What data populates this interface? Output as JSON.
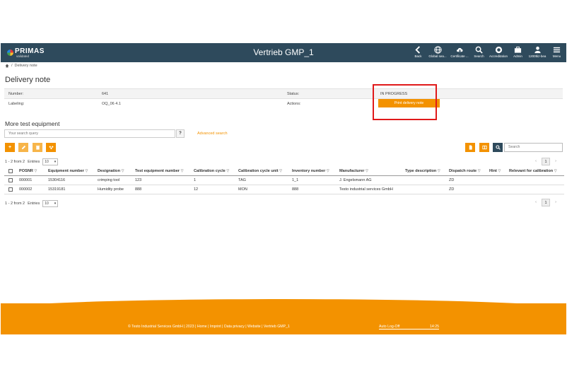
{
  "header": {
    "logo_text": "PRIMAS",
    "logo_sub": "validated",
    "title": "Vertrieb GMP_1",
    "nav": [
      {
        "label": "Back",
        "icon": "back-icon"
      },
      {
        "label": "Global sea...",
        "icon": "globe-icon"
      },
      {
        "label": "Certificate ...",
        "icon": "cloud-download-icon"
      },
      {
        "label": "Search",
        "icon": "search-icon"
      },
      {
        "label": "Accreditation",
        "icon": "seal-icon"
      },
      {
        "label": "Admin",
        "icon": "briefcase-icon"
      },
      {
        "label": "1200tkz-bea",
        "icon": "user-icon"
      },
      {
        "label": "Menu",
        "icon": "menu-icon"
      }
    ]
  },
  "breadcrumb": {
    "current": "Delivery note"
  },
  "page_title": "Delivery note",
  "info": {
    "number_label": "Number:",
    "number_value": "641",
    "labeling_label": "Labeling:",
    "labeling_value": "OQ_06 4.1",
    "status_label": "Status:",
    "status_value": "IN PROGRESS",
    "actions_label": "Actions:",
    "print_button": "Print delivery note"
  },
  "section": {
    "title": "More test equipment",
    "search_placeholder": "Your search query",
    "help": "?",
    "advanced_search": "Advanced search",
    "search_right_placeholder": "Search"
  },
  "toolbar": {
    "add_label": "+"
  },
  "pagination": {
    "summary": "1 - 2 from 2",
    "entries_label": "Entries",
    "entries_value": "10",
    "current_page": "1",
    "prev": "‹",
    "next": "›"
  },
  "table": {
    "headers": [
      "POSNR",
      "Equipment number",
      "Designation",
      "Test equipment number",
      "Calibration cycle",
      "Calibration cycle unit",
      "Inventory number",
      "Manufacturer",
      "Type description",
      "Dispatch route",
      "Hint",
      "Relevant for calibration"
    ],
    "rows": [
      [
        "000001",
        "15304116",
        "crimping tool",
        "123",
        "1",
        "TAG",
        "1_1",
        "J. Engelsmann AG",
        "",
        "ZD",
        "",
        ""
      ],
      [
        "000002",
        "15319181",
        "Humidity probe",
        "888",
        "12",
        "MON",
        "888",
        "Testo industrial services GmbH",
        "",
        "ZD",
        "",
        ""
      ]
    ]
  },
  "footer": {
    "text": "© Testo Industrial Services GmbH | 2023 | Home | Imprint | Data privacy | Website | Vertrieb GMP_1",
    "auto_logoff_label": "Auto Log-Off",
    "auto_logoff_time": "14:25"
  },
  "colors": {
    "topbar": "#2e4a5c",
    "accent": "#f39200",
    "highlight": "#e0191a"
  }
}
